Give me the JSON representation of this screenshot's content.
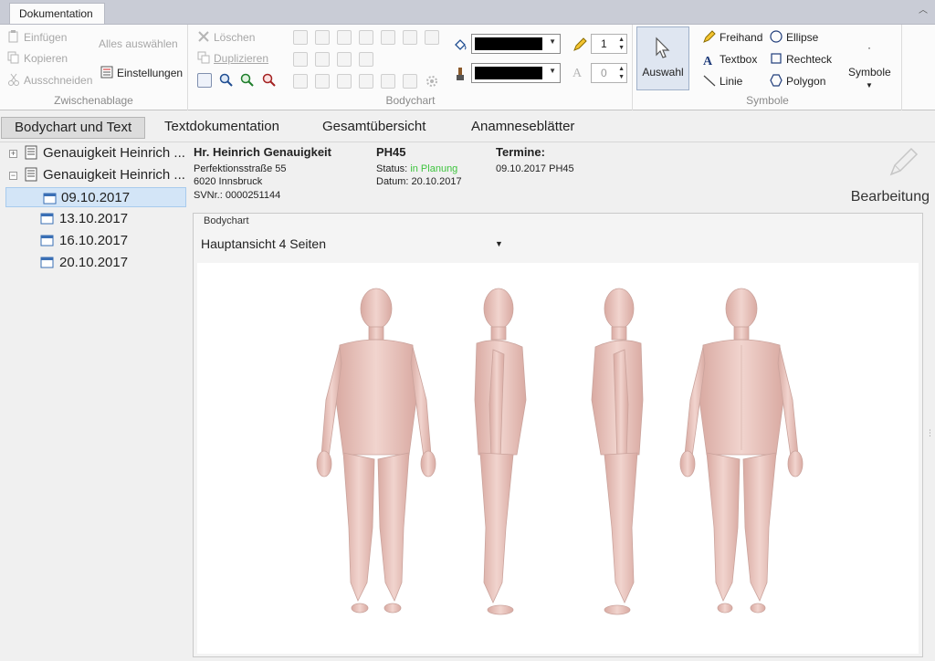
{
  "ribbon_tab": "Dokumentation",
  "zwischenablage": {
    "label": "Zwischenablage",
    "einfuegen": "Einfügen",
    "kopieren": "Kopieren",
    "ausschneiden": "Ausschneiden",
    "alles_auswaehlen": "Alles auswählen",
    "einstellungen": "Einstellungen"
  },
  "bodychart_group": {
    "label": "Bodychart",
    "loeschen": "Löschen",
    "duplizieren": "Duplizieren",
    "line_width": "1",
    "font_size": "0"
  },
  "symbole": {
    "label": "Symbole",
    "auswahl": "Auswahl",
    "freihand": "Freihand",
    "textbox": "Textbox",
    "linie": "Linie",
    "ellipse": "Ellipse",
    "rechteck": "Rechteck",
    "polygon": "Polygon",
    "symbole_btn": "Symbole"
  },
  "nav_tabs": [
    "Bodychart und Text",
    "Textdokumentation",
    "Gesamtübersicht",
    "Anamneseblätter"
  ],
  "tree": {
    "nodes": [
      "Genauigkeit Heinrich ...",
      "Genauigkeit Heinrich ..."
    ],
    "dates": [
      "09.10.2017",
      "13.10.2017",
      "16.10.2017",
      "20.10.2017"
    ]
  },
  "patient": {
    "name": "Hr. Heinrich Genauigkeit",
    "street": "Perfektionsstraße 55",
    "city": "6020 Innsbruck",
    "svnr": "SVNr.: 0000251144"
  },
  "case": {
    "code": "PH45",
    "status_label": "Status:",
    "status_value": "in Planung",
    "date": "Datum: 20.10.2017"
  },
  "termine": {
    "title": "Termine:",
    "entry": "09.10.2017 PH45"
  },
  "edit_label": "Bearbeitung",
  "panel": {
    "title": "Bodychart",
    "view": "Hauptansicht 4 Seiten"
  },
  "colors": {
    "status": "#3ec43e",
    "selection": "#d3e5f7",
    "muscle": "#e7c3bd"
  }
}
